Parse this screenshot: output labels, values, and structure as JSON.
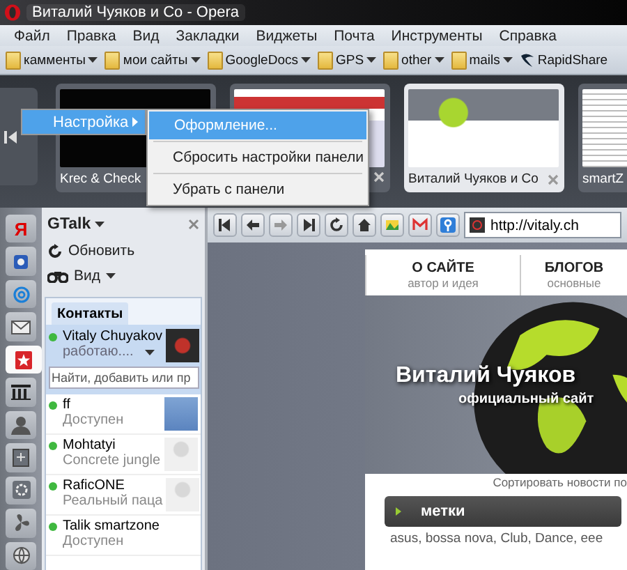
{
  "window": {
    "title": "Виталий Чуяков и Co - Opera"
  },
  "menu_bar": [
    "Файл",
    "Правка",
    "Вид",
    "Закладки",
    "Виджеты",
    "Почта",
    "Инструменты",
    "Справка"
  ],
  "bookmarks": [
    {
      "label": "камменты",
      "kind": "folder"
    },
    {
      "label": "мои сайты",
      "kind": "folder"
    },
    {
      "label": "GoogleDocs",
      "kind": "folder"
    },
    {
      "label": "GPS",
      "kind": "folder"
    },
    {
      "label": "other",
      "kind": "folder"
    },
    {
      "label": "mails",
      "kind": "folder"
    },
    {
      "label": "RapidShare",
      "kind": "link"
    }
  ],
  "tabs": [
    {
      "title": "Krec & Check",
      "kind": "dark",
      "selected": false,
      "close_button": false
    },
    {
      "kind": "light",
      "selected": false,
      "close_button": true
    },
    {
      "title": "Виталий Чуяков и Co",
      "kind": "site",
      "selected": true,
      "close_button": true
    },
    {
      "title": "smartZ",
      "kind": "document",
      "selected": false,
      "close_button": false
    }
  ],
  "context_menu": {
    "parent_item": {
      "label": "Настройка",
      "selected": true
    },
    "items": [
      {
        "label": "Оформление...",
        "selected": true
      },
      {
        "label": "Сбросить настройки панели",
        "selected": false
      },
      {
        "label": "Убрать с панели",
        "selected": false
      }
    ]
  },
  "panel_icons": [
    {
      "kind": "letter",
      "label": "Я",
      "selected": false
    },
    {
      "kind": "bookmarks",
      "selected": false
    },
    {
      "kind": "at",
      "selected": false
    },
    {
      "kind": "mail",
      "selected": false
    },
    {
      "kind": "star",
      "selected": true
    },
    {
      "kind": "film",
      "selected": false
    },
    {
      "kind": "person",
      "selected": false
    },
    {
      "kind": "note",
      "selected": false
    },
    {
      "kind": "gear",
      "selected": false
    },
    {
      "kind": "fan",
      "selected": false
    },
    {
      "kind": "globe",
      "selected": false
    }
  ],
  "gtalk": {
    "title": "GTalk",
    "actions": [
      {
        "kind": "refresh",
        "label": "Обновить"
      },
      {
        "kind": "view",
        "label": "Вид"
      }
    ],
    "tab": "Контакты",
    "me": {
      "name": "Vitaly Chuyakov",
      "status": "работаю...."
    },
    "search": {
      "placeholder": "Найти, добавить или пр"
    },
    "contacts": [
      {
        "name": "ff",
        "status": "Доступен",
        "kind": "logo"
      },
      {
        "name": "Mohtatyi",
        "status": "Concrete jungle",
        "kind": "blank"
      },
      {
        "name": "RaficONE",
        "status": "Реальный паца",
        "kind": "blank"
      },
      {
        "name": "Talik smartzone",
        "status": "Доступен",
        "kind": "none"
      }
    ]
  },
  "browser": {
    "url": "http://vitaly.ch",
    "page": {
      "nav": [
        {
          "title": "О САЙТЕ",
          "subtitle": "автор и идея"
        },
        {
          "title": "БЛОГОВ",
          "subtitle": "основные"
        }
      ],
      "banner_title": "Виталий Чуяков",
      "banner_subtitle": "официальный сайт",
      "sort_text": "Сортировать новости по",
      "tags_heading": "метки",
      "tags": "asus, bossa nova, Club, Dance, eee"
    }
  }
}
